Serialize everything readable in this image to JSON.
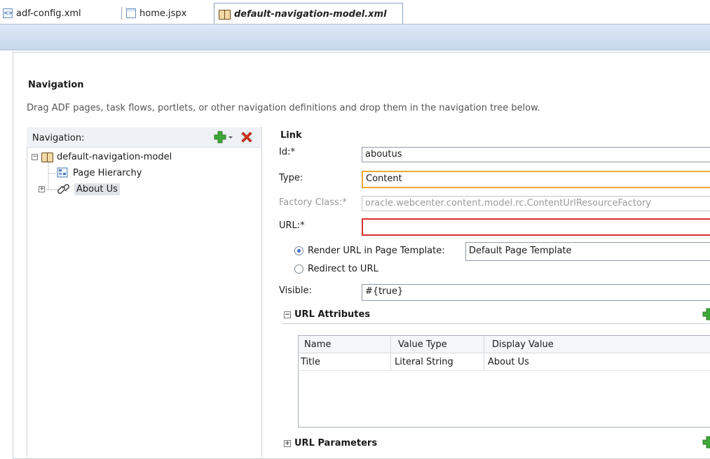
{
  "tabs": [
    {
      "label": "adf-config.xml",
      "icon": "xml-file-icon"
    },
    {
      "label": "home.jspx",
      "icon": "jspx-file-icon"
    },
    {
      "label": "default-navigation-model.xml",
      "icon": "navigation-model-icon",
      "active": true
    }
  ],
  "page": {
    "title": "Navigation",
    "description": "Drag ADF pages, task flows, portlets, or other navigation definitions and drop them in the navigation tree below."
  },
  "nav": {
    "header": "Navigation:",
    "tree": [
      {
        "label": "default-navigation-model",
        "expander": "−"
      },
      {
        "label": "Page Hierarchy"
      },
      {
        "label": "About Us",
        "expander": "+",
        "selected": true
      }
    ]
  },
  "form": {
    "section": "Link",
    "id_label": "Id:*",
    "id_value": "aboutus",
    "type_label": "Type:",
    "type_value": "Content",
    "factory_label": "Factory Class:*",
    "factory_value": "oracle.webcenter.content.model.rc.ContentUrlResourceFactory",
    "url_label": "URL:*",
    "url_value": "",
    "render_label": "Render URL in Page Template:",
    "render_value": "Default Page Template",
    "redirect_label": "Redirect to URL",
    "visible_label": "Visible:",
    "visible_value": "#{true}"
  },
  "attributes": {
    "header": "URL Attributes",
    "columns": [
      "Name",
      "Value Type",
      "Display Value"
    ],
    "rows": [
      [
        "Title",
        "Literal String",
        "About Us"
      ]
    ]
  },
  "parameters": {
    "header": "URL Parameters"
  },
  "colors": {
    "accent_plus": "#3fa83a",
    "delete_red": "#d6361f",
    "focus_border": "#f0a830",
    "error_border": "#d93030"
  }
}
